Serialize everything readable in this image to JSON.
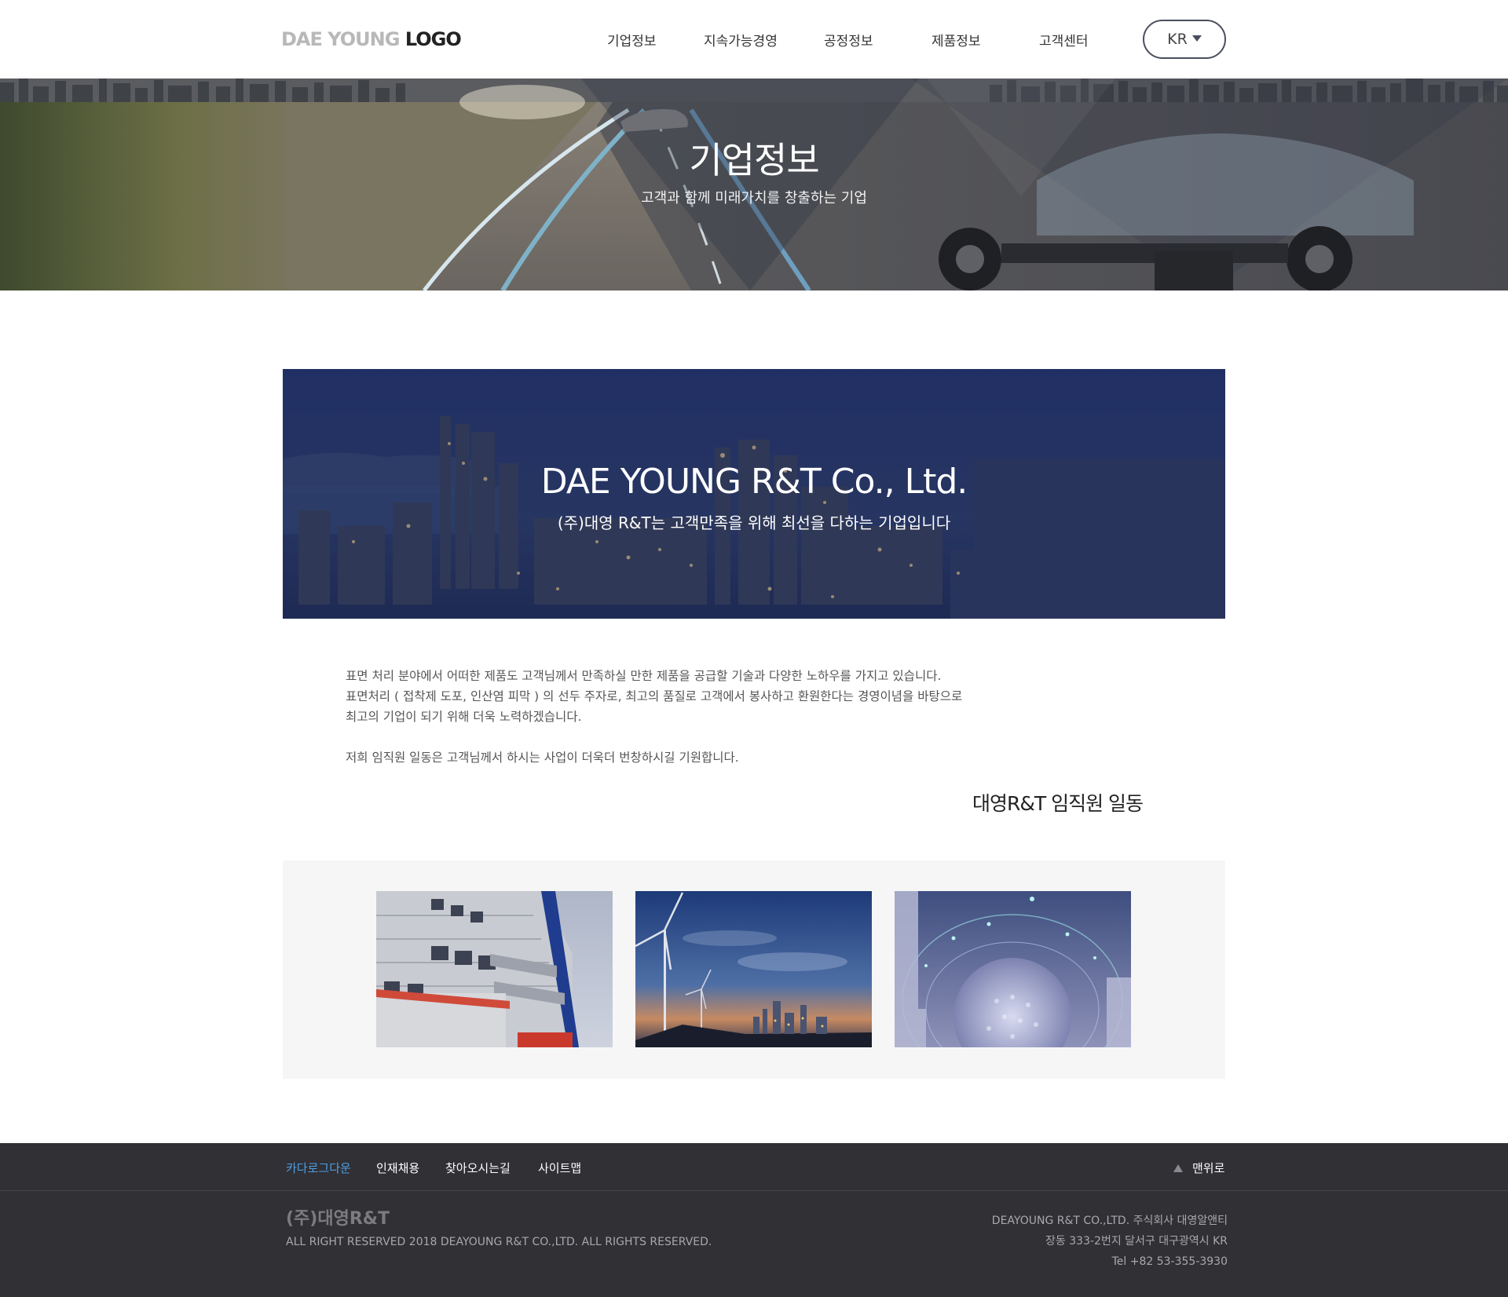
{
  "header": {
    "logo_light": "DAE YOUNG",
    "logo_dark": "LOGO",
    "nav": [
      {
        "label": "기업정보"
      },
      {
        "label": "지속가능경영"
      },
      {
        "label": "공정정보"
      },
      {
        "label": "제품정보"
      },
      {
        "label": "고객센터"
      }
    ],
    "language": "KR"
  },
  "banner": {
    "title": "기업정보",
    "subtitle": "고객과 함께 미래가치를 창출하는 기업"
  },
  "company": {
    "title": "DAE YOUNG R&T Co., Ltd.",
    "subtitle": "(주)대영 R&T는 고객만족을 위해 최선을 다하는 기업입니다"
  },
  "intro": {
    "line1": "표면 처리 분야에서 어떠한 제품도 고객님께서 만족하실 만한 제품을 공급할 기술과 다양한 노하우를 가지고 있습니다.",
    "line2": "표면처리 ( 접착제 도포, 인산염 피막 ) 의 선두 주자로, 최고의 품질로 고객에서 봉사하고 환원한다는 경영이념을 바탕으로",
    "line3": "최고의 기업이 되기 위해 더욱 노력하겠습니다.",
    "line4": "저희 임직원 일동은 고객님께서 하시는 사업이 더욱더 번창하시길 기원합니다.",
    "signature": "대영R&T 임직원 일동"
  },
  "footer": {
    "links": [
      {
        "label": "카다로그다운"
      },
      {
        "label": "인재채용"
      },
      {
        "label": "찾아오시는길"
      },
      {
        "label": "사이트맵"
      }
    ],
    "to_top": "맨위로",
    "brand": "(주)대영R&T",
    "copyright": "ALL RIGHT RESERVED 2018 DEAYOUNG R&T CO.,LTD. ALL RIGHTS RESERVED.",
    "company_name": "DEAYOUNG  R&T CO.,LTD. 주식회사 대영알앤티",
    "address": "장동 333-2번지 달서구 대구광역시 KR",
    "tel": "Tel +82 53-355-3930"
  },
  "colors": {
    "footer_bg": "#303035",
    "footer_active_link": "#4da0e6",
    "company_banner": "#27365f"
  }
}
